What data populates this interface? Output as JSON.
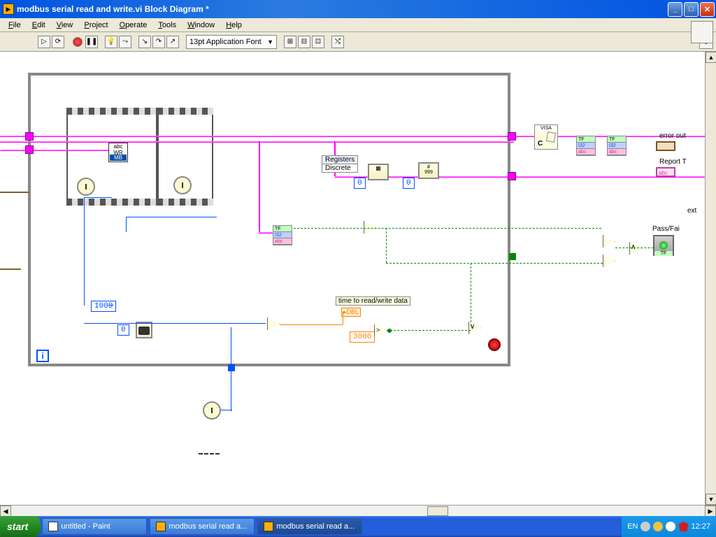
{
  "window": {
    "title": "modbus serial read and write.vi Block Diagram *"
  },
  "menu": {
    "file": "File",
    "edit": "Edit",
    "view": "View",
    "project": "Project",
    "operate": "Operate",
    "tools": "Tools",
    "window": "Window",
    "help": "Help"
  },
  "toolbar": {
    "font": "13pt Application Font"
  },
  "diagram": {
    "registers_label": "Registers",
    "discrete_label": "Discrete",
    "time_label": "time to read/write data",
    "const_zero_a": "0",
    "const_zero_b": "0",
    "const_zero_c": "0",
    "const_1000": "1000",
    "const_3000": "3000",
    "const_999": "999",
    "dbl_label": "DBL",
    "visa_c": "C",
    "iter": "i",
    "error_out": "error out",
    "report_t": "Report T",
    "pass_fail": "Pass/Fai",
    "ext": "ext",
    "tf_label": "TF",
    "abc_label": "abc",
    "and_sym": "∧",
    "or_sym": "∨",
    "mb_wr": "WR",
    "arr_label": "#"
  },
  "taskbar": {
    "start": "start",
    "paint": "untitled - Paint",
    "lv1": "modbus serial read a...",
    "lv2": "modbus serial read a...",
    "lang": "EN",
    "time": "12:27"
  }
}
